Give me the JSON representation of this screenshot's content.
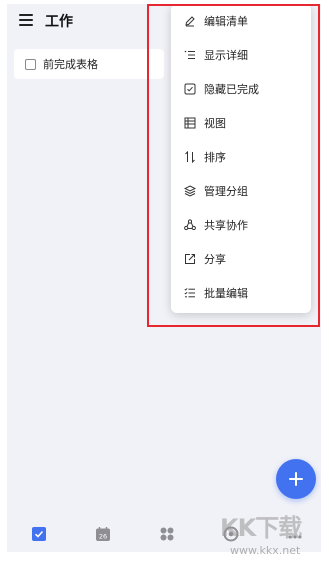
{
  "header": {
    "title": "工作"
  },
  "task": {
    "title": "前完成表格"
  },
  "menu": {
    "items": [
      {
        "label": "编辑清单",
        "icon": "pencil-icon"
      },
      {
        "label": "显示详细",
        "icon": "list-details-icon"
      },
      {
        "label": "隐藏已完成",
        "icon": "hide-completed-icon"
      },
      {
        "label": "视图",
        "icon": "view-icon"
      },
      {
        "label": "排序",
        "icon": "sort-icon"
      },
      {
        "label": "管理分组",
        "icon": "layers-icon"
      },
      {
        "label": "共享协作",
        "icon": "share-collab-icon"
      },
      {
        "label": "分享",
        "icon": "export-icon"
      },
      {
        "label": "批量编辑",
        "icon": "batch-edit-icon"
      }
    ]
  },
  "bottom_nav": {
    "calendar_day": "26",
    "items": [
      "tasks-nav-icon",
      "calendar-nav-icon",
      "apps-nav-icon",
      "focus-nav-icon",
      "more-nav-icon"
    ]
  },
  "watermark": {
    "brand": "KK下载",
    "url": "www.kkx.net"
  },
  "colors": {
    "accent": "#4272ef",
    "highlight": "#e8262f",
    "background": "#f1f2f7"
  }
}
